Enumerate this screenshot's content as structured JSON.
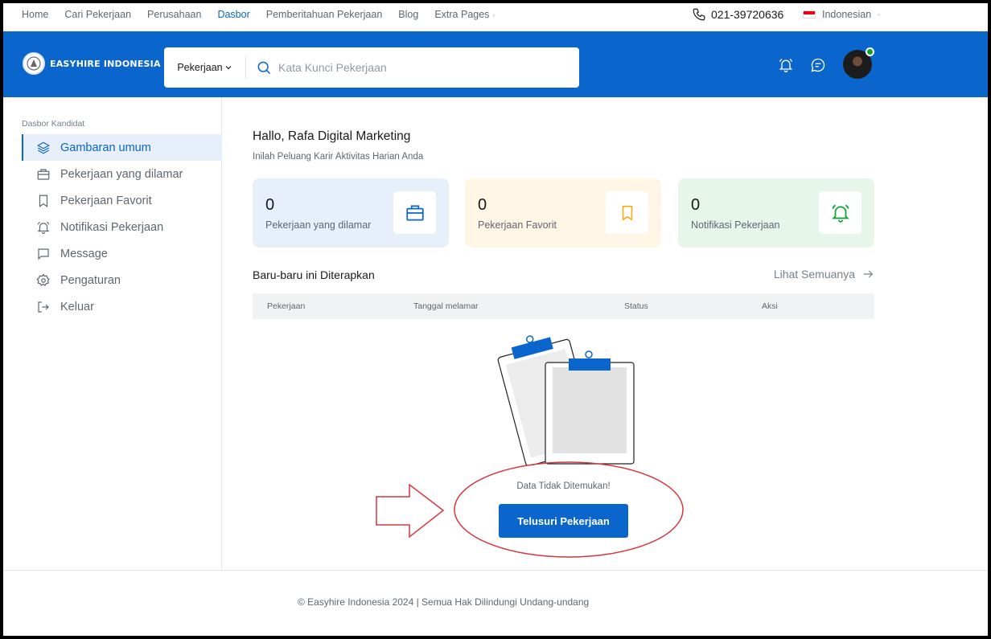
{
  "topnav": {
    "links": [
      {
        "label": "Home"
      },
      {
        "label": "Cari Pekerjaan"
      },
      {
        "label": "Perusahaan"
      },
      {
        "label": "Dasbor"
      },
      {
        "label": "Pemberitahuan Pekerjaan"
      },
      {
        "label": "Blog"
      },
      {
        "label": "Extra Pages"
      }
    ],
    "active_link": "Dasbor",
    "phone": "021-39720636",
    "language": "Indonesian"
  },
  "header": {
    "brand": "EASYHIRE INDONESIA",
    "search": {
      "category": "Pekerjaan",
      "placeholder": "Kata Kunci Pekerjaan",
      "value": ""
    },
    "user_online": true
  },
  "sidebar": {
    "title": "Dasbor Kandidat",
    "items": [
      {
        "label": "Gambaran umum",
        "icon": "layers-icon",
        "active": true
      },
      {
        "label": "Pekerjaan yang dilamar",
        "icon": "briefcase-icon"
      },
      {
        "label": "Pekerjaan Favorit",
        "icon": "bookmark-icon"
      },
      {
        "label": "Notifikasi Pekerjaan",
        "icon": "bell-icon"
      },
      {
        "label": "Message",
        "icon": "message-icon"
      },
      {
        "label": "Pengaturan",
        "icon": "gear-icon"
      },
      {
        "label": "Keluar",
        "icon": "logout-icon"
      }
    ]
  },
  "main": {
    "greeting": "Hallo, Rafa Digital Marketing",
    "subtitle": "Inilah Peluang Karir Aktivitas Harian Anda",
    "stats": [
      {
        "value": "0",
        "label": "Pekerjaan yang dilamar",
        "icon": "briefcase-icon",
        "bg": "#e7f0fa",
        "color": "#0a65cc"
      },
      {
        "value": "0",
        "label": "Pekerjaan Favorit",
        "icon": "bookmark-icon",
        "bg": "#fff6e6",
        "color": "#ffa500"
      },
      {
        "value": "0",
        "label": "Notifikasi Pekerjaan",
        "icon": "bell-icon",
        "bg": "#e7f6ea",
        "color": "#0ba02c"
      }
    ],
    "recent_title": "Baru-baru ini Diterapkan",
    "see_all": "Lihat Semuanya",
    "table_headers": [
      "Pekerjaan",
      "Tanggal melamar",
      "Status",
      "Aksi"
    ],
    "empty_text": "Data Tidak Ditemukan!",
    "browse_button": "Telusuri Pekerjaan"
  },
  "footer": {
    "copyright": "© Easyhire Indonesia 2024 | Semua Hak Dilindungi Undang-undang"
  },
  "colors": {
    "primary": "#0a65cc",
    "annotation": "#d9363e"
  }
}
